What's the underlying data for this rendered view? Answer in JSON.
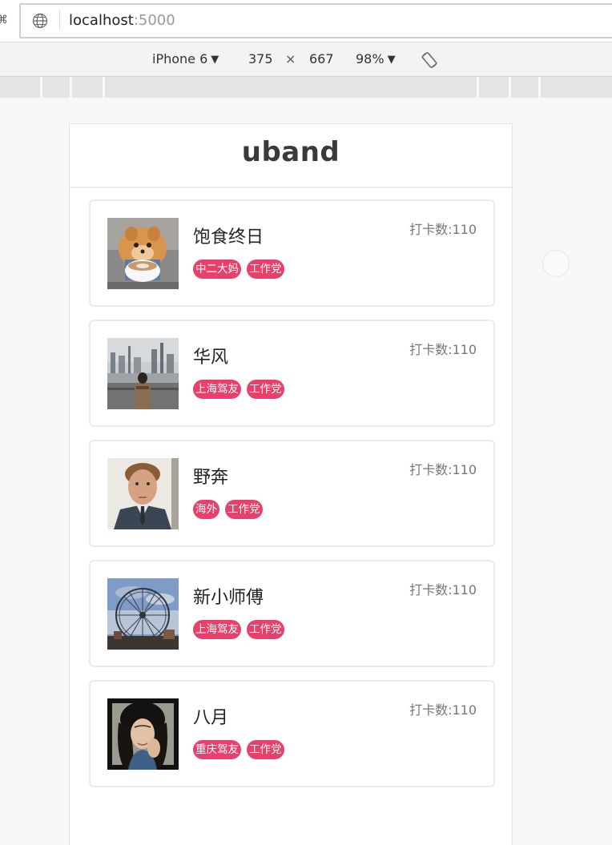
{
  "browser": {
    "url_host": "localhost",
    "url_port": ":5000",
    "icons": {
      "site": "globe-icon",
      "rotate": "rotate-icon",
      "dropdown": "caret-down-icon"
    }
  },
  "device_toolbar": {
    "device": "iPhone 6",
    "width": "375",
    "times": "×",
    "height": "667",
    "zoom": "98%"
  },
  "app": {
    "logo": "uband"
  },
  "members": [
    {
      "name": "饱食终日",
      "tags": [
        "中二大妈",
        "工作党"
      ],
      "count": "打卡数:110",
      "avatar": "puppy-with-coffee-avatar"
    },
    {
      "name": "华风",
      "tags": [
        "上海驾友",
        "工作党"
      ],
      "count": "打卡数:110",
      "avatar": "man-city-skyline-avatar"
    },
    {
      "name": "野奔",
      "tags": [
        "海外",
        "工作党"
      ],
      "count": "打卡数:110",
      "avatar": "man-portrait-avatar"
    },
    {
      "name": "新小师傅",
      "tags": [
        "上海驾友",
        "工作党"
      ],
      "count": "打卡数:110",
      "avatar": "ferris-wheel-avatar"
    },
    {
      "name": "八月",
      "tags": [
        "重庆驾友",
        "工作党"
      ],
      "count": "打卡数:110",
      "avatar": "woman-portrait-avatar"
    }
  ],
  "colors": {
    "tag_bg": "#e8406a",
    "logo": "#3a3a3a",
    "count_text": "#777777"
  }
}
